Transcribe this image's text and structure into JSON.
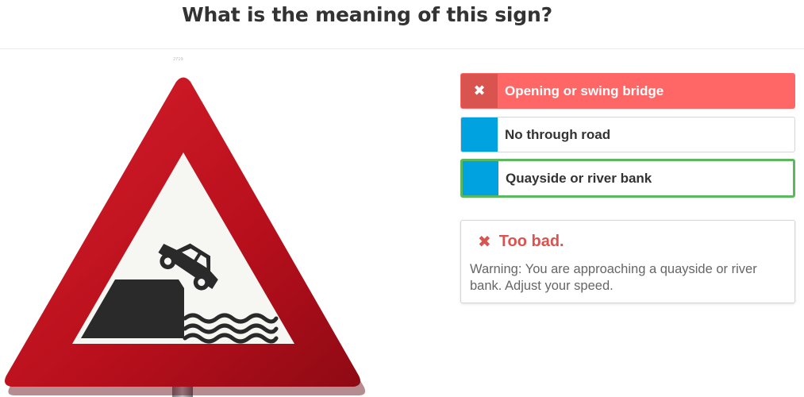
{
  "question": "What is the meaning of this sign?",
  "photo_credit": "2719",
  "answers": [
    {
      "label": "Opening or swing bridge",
      "marker": "✖",
      "state": "wrong"
    },
    {
      "label": "No through road",
      "marker": "",
      "state": "neutral"
    },
    {
      "label": "Quayside or river bank",
      "marker": "",
      "state": "correct"
    }
  ],
  "feedback": {
    "icon": "✖",
    "title": "Too bad.",
    "text": "Warning: You are approaching a quayside or river bank. Adjust your speed."
  },
  "colors": {
    "wrong": "#ff6767",
    "wrong_marker": "#d9534f",
    "neutral_marker": "#00a3e0",
    "correct_border": "#5cb85c",
    "sign_red": "#c0101c"
  }
}
